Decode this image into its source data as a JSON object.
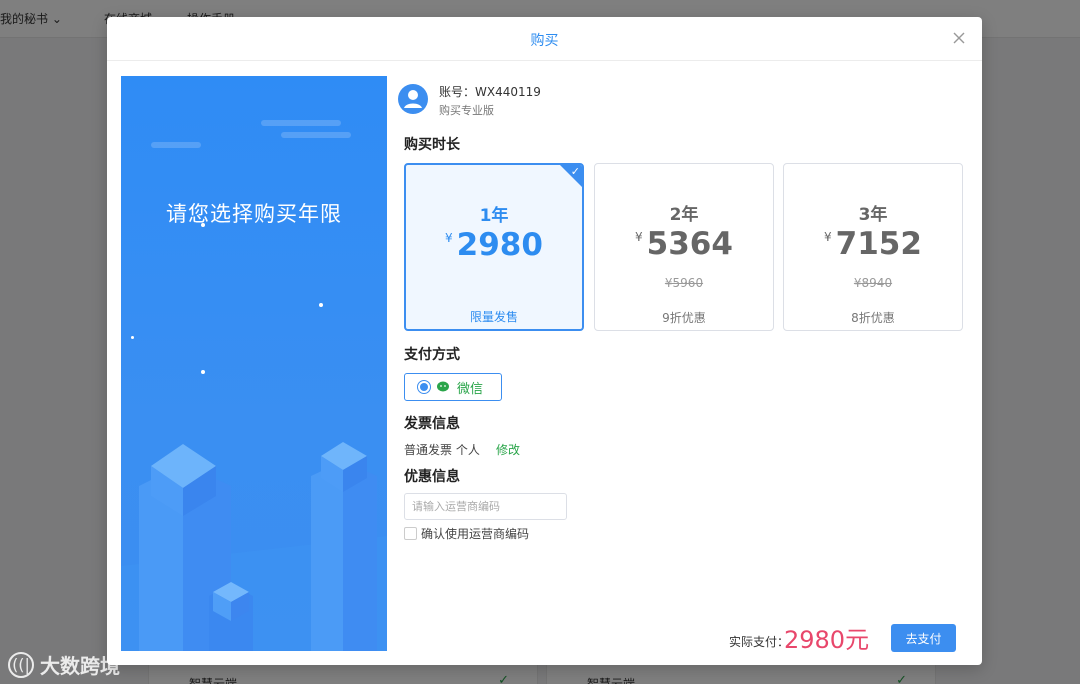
{
  "background": {
    "nav": [
      "我的秘书 ⌄",
      "在线商城",
      "操作手册"
    ],
    "cards": [
      {
        "label": "智慧云端"
      },
      {
        "label": "智慧云端"
      }
    ]
  },
  "watermark": {
    "logo_text": "((|",
    "text": "大数跨境"
  },
  "modal": {
    "title": "购买",
    "banner": {
      "headline": "请您选择购买年限"
    },
    "account": {
      "id_text": "账号：WX440119",
      "subtitle": "购买专业版"
    },
    "duration": {
      "title": "购买时长",
      "currency": "¥",
      "plans": [
        {
          "years": "1年",
          "price": "2980",
          "original": "",
          "tag": "限量发售",
          "selected": true
        },
        {
          "years": "2年",
          "price": "5364",
          "original": "¥5960",
          "tag": "9折优惠",
          "selected": false
        },
        {
          "years": "3年",
          "price": "7152",
          "original": "¥8940",
          "tag": "8折优惠",
          "selected": false
        }
      ]
    },
    "payment": {
      "title": "支付方式",
      "method": "微信",
      "selected": true
    },
    "invoice": {
      "title": "发票信息",
      "text": "普通发票  个人",
      "edit_label": "修改"
    },
    "coupon": {
      "title": "优惠信息",
      "placeholder": "请输入运营商编码",
      "value": "",
      "confirm_label": "确认使用运营商编码",
      "confirmed": false
    },
    "footer": {
      "total_label": "实际支付：",
      "total_value": "2980元",
      "pay_button": "去支付"
    }
  },
  "colors": {
    "accent": "#3c8ef0",
    "wechat_green": "#2aa54a",
    "total_red": "#e8476b",
    "banner_blue": "#2f8cf5"
  }
}
